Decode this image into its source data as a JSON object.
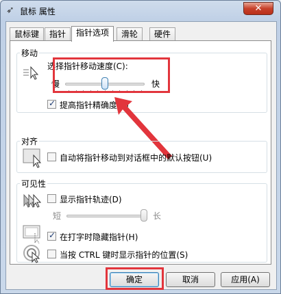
{
  "window": {
    "title": "鼠标 属性",
    "close_glyph": "✕"
  },
  "tabs": [
    "鼠标键",
    "指针",
    "指针选项",
    "滑轮",
    "硬件"
  ],
  "motion": {
    "group_title": "移动",
    "speed_label": "选择指针移动速度(C):",
    "slow_label": "慢",
    "fast_label": "快",
    "speed_value_fraction": 0.5,
    "enhance_precision_label": "提高指针精确度(E)",
    "enhance_precision_checked": true
  },
  "snap_to": {
    "group_title": "对齐",
    "snap_label": "自动将指针移动到对话框中的默认按钮(U)",
    "snap_checked": false
  },
  "visibility": {
    "group_title": "可见性",
    "trails_label": "显示指针轨迹(D)",
    "trails_checked": false,
    "short_label": "短",
    "long_label": "长",
    "trail_length_fraction": 1.0,
    "hide_typing_label": "在打字时隐藏指针(H)",
    "hide_typing_checked": true,
    "show_ctrl_label": "当按 CTRL 键时显示指针的位置(S)",
    "show_ctrl_checked": false
  },
  "buttons": {
    "ok": "确定",
    "cancel": "取消",
    "apply": "应用(A)"
  },
  "colors": {
    "highlight": "#e2353c",
    "accent": "#3c7fb1"
  }
}
